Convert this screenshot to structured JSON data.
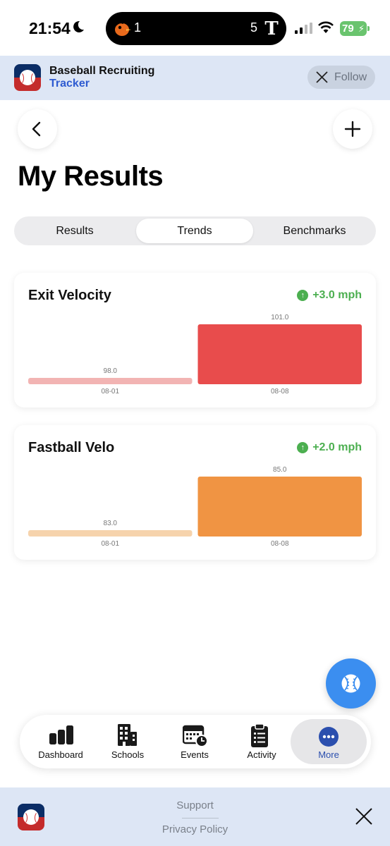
{
  "status_bar": {
    "time": "21:54",
    "game": {
      "left_score": "1",
      "right_score": "5",
      "right_team_letter": "T"
    },
    "battery": "79"
  },
  "banner": {
    "app_name_line1": "Baseball Recruiting",
    "app_name_line2": "Tracker",
    "follow_label": "Follow"
  },
  "page": {
    "title": "My Results"
  },
  "tabs": [
    {
      "label": "Results",
      "selected": false
    },
    {
      "label": "Trends",
      "selected": true
    },
    {
      "label": "Benchmarks",
      "selected": false
    }
  ],
  "cards": [
    {
      "title": "Exit Velocity",
      "delta": "+3.0 mph",
      "chart_data": {
        "type": "bar",
        "categories": [
          "08-01",
          "08-08"
        ],
        "values": [
          98.0,
          101.0
        ],
        "value_labels": [
          "98.0",
          "101.0"
        ],
        "color": "#e84c4c",
        "faded_color": "#f2b4b3",
        "ylim": [
          98.0,
          101.0
        ]
      }
    },
    {
      "title": "Fastball Velo",
      "delta": "+2.0 mph",
      "chart_data": {
        "type": "bar",
        "categories": [
          "08-01",
          "08-08"
        ],
        "values": [
          83.0,
          85.0
        ],
        "value_labels": [
          "83.0",
          "85.0"
        ],
        "color": "#f09443",
        "faded_color": "#f6d3ac",
        "ylim": [
          83.0,
          85.0
        ]
      }
    }
  ],
  "bottom_nav": [
    {
      "label": "Dashboard",
      "icon": "bar-chart-icon"
    },
    {
      "label": "Schools",
      "icon": "building-icon"
    },
    {
      "label": "Events",
      "icon": "calendar-clock-icon"
    },
    {
      "label": "Activity",
      "icon": "clipboard-icon"
    },
    {
      "label": "More",
      "icon": "more-icon",
      "active": true
    }
  ],
  "footer": {
    "support_label": "Support",
    "privacy_label": "Privacy Policy"
  },
  "colors": {
    "accent_blue": "#2e5bd1",
    "positive_green": "#4caf50",
    "fab_blue": "#3b8ef0",
    "banner_bg": "#dde6f5"
  }
}
